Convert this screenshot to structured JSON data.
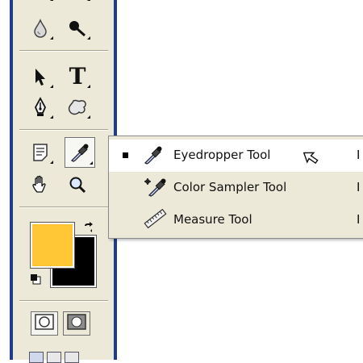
{
  "toolbar": {
    "tools": [
      {
        "id": "blur",
        "icon": "blur-drop-icon"
      },
      {
        "id": "burn",
        "icon": "burn-icon"
      },
      {
        "id": "path-select",
        "icon": "path-selection-arrow-icon"
      },
      {
        "id": "type",
        "icon": "type-icon",
        "glyph": "T"
      },
      {
        "id": "pen",
        "icon": "pen-icon"
      },
      {
        "id": "custom-shape",
        "icon": "custom-shape-icon"
      },
      {
        "id": "notes",
        "icon": "notes-icon"
      },
      {
        "id": "eyedropper",
        "icon": "eyedropper-icon",
        "active": true
      },
      {
        "id": "hand",
        "icon": "hand-icon"
      },
      {
        "id": "zoom",
        "icon": "zoom-icon"
      }
    ],
    "foreground_color": "#ffc635",
    "background_color": "#000000"
  },
  "flyout": {
    "items": [
      {
        "label": "Eyedropper Tool",
        "shortcut": "I",
        "selected": true,
        "icon": "eyedropper-icon"
      },
      {
        "label": "Color Sampler Tool",
        "shortcut": "I",
        "selected": false,
        "icon": "color-sampler-icon"
      },
      {
        "label": "Measure Tool",
        "shortcut": "I",
        "selected": false,
        "icon": "measure-icon"
      }
    ]
  }
}
